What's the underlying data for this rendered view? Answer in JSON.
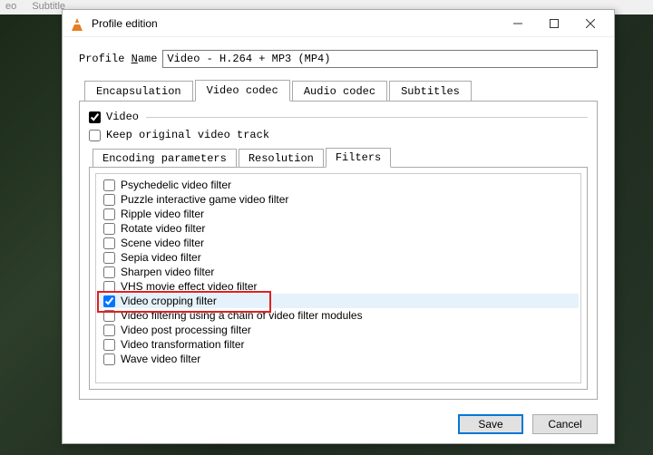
{
  "bg_menu": {
    "item1": "eo",
    "item2": "Subtitle"
  },
  "window": {
    "title": "Profile edition"
  },
  "profile": {
    "label_pre": "Profile ",
    "label_under": "N",
    "label_post": "ame",
    "value": "Video - H.264 + MP3 (MP4)"
  },
  "outer_tabs": {
    "encapsulation": "Encapsulation",
    "video_codec": "Video codec",
    "audio_codec": "Audio codec",
    "subtitles": "Subtitles"
  },
  "video_section": {
    "video_label": "Video",
    "keep_label": "Keep original video track"
  },
  "inner_tabs": {
    "encoding": "Encoding parameters",
    "resolution": "Resolution",
    "filters": "Filters"
  },
  "filters": [
    {
      "label": "Psychedelic video filter",
      "checked": false,
      "selected": false
    },
    {
      "label": "Puzzle interactive game video filter",
      "checked": false,
      "selected": false
    },
    {
      "label": "Ripple video filter",
      "checked": false,
      "selected": false
    },
    {
      "label": "Rotate video filter",
      "checked": false,
      "selected": false
    },
    {
      "label": "Scene video filter",
      "checked": false,
      "selected": false
    },
    {
      "label": "Sepia video filter",
      "checked": false,
      "selected": false
    },
    {
      "label": "Sharpen video filter",
      "checked": false,
      "selected": false
    },
    {
      "label": "VHS movie effect video filter",
      "checked": false,
      "selected": false
    },
    {
      "label": "Video cropping filter",
      "checked": true,
      "selected": true
    },
    {
      "label": "Video filtering using a chain of video filter modules",
      "checked": false,
      "selected": false
    },
    {
      "label": "Video post processing filter",
      "checked": false,
      "selected": false
    },
    {
      "label": "Video transformation filter",
      "checked": false,
      "selected": false
    },
    {
      "label": "Wave video filter",
      "checked": false,
      "selected": false
    }
  ],
  "buttons": {
    "save": "Save",
    "cancel": "Cancel"
  }
}
